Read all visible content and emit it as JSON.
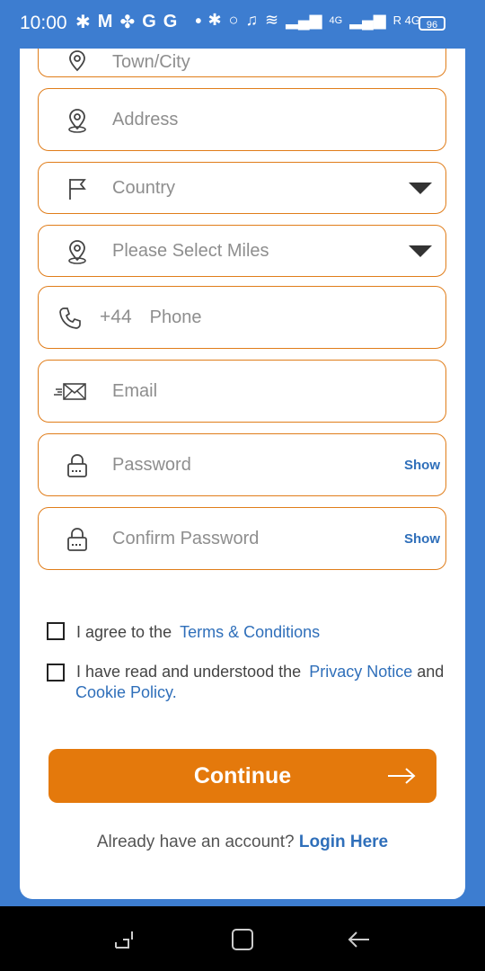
{
  "status_bar": {
    "time": "10:00",
    "left_icons": [
      "gear-icon",
      "gmail-icon",
      "pinwheel-icon",
      "google-icon",
      "google-icon",
      "dot-icon"
    ],
    "right_icons": [
      "bluetooth-icon",
      "location-icon",
      "mute-icon",
      "wifi-icon",
      "signal-icon",
      "signal-icon"
    ],
    "network_1": "4G",
    "network_2": "R 4G",
    "battery": "96"
  },
  "form": {
    "town_placeholder": "Town/City",
    "address_placeholder": "Address",
    "country_placeholder": "Country",
    "miles_placeholder": "Please Select Miles",
    "phone_prefix": "+44",
    "phone_placeholder": "Phone",
    "email_placeholder": "Email",
    "password_placeholder": "Password",
    "confirm_password_placeholder": "Confirm Password",
    "show_label": "Show"
  },
  "agreements": {
    "terms_prefix": "I agree to the",
    "terms_link": "Terms & Conditions",
    "privacy_prefix": "I have read and understood the",
    "privacy_link": "Privacy Notice",
    "privacy_and": "and",
    "cookie_link": "Cookie Policy."
  },
  "actions": {
    "continue_label": "Continue",
    "login_prompt": "Already have an account?",
    "login_link": "Login Here"
  },
  "colors": {
    "accent": "#e4790c",
    "link": "#2f6fba",
    "background": "#3d7dd0"
  }
}
